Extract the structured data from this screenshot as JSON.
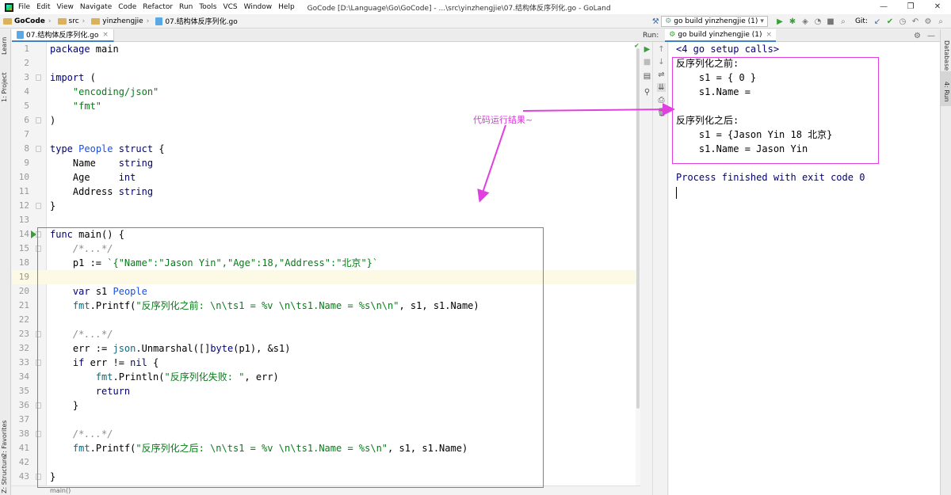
{
  "window": {
    "menu": [
      "File",
      "Edit",
      "View",
      "Navigate",
      "Code",
      "Refactor",
      "Run",
      "Tools",
      "VCS",
      "Window",
      "Help"
    ],
    "title": "GoCode [D:\\Language\\Go\\GoCode] - ...\\src\\yinzhengjie\\07.结构体反序列化.go - GoLand",
    "controls": [
      "—",
      "❐",
      "✕"
    ]
  },
  "navbar": {
    "breadcrumbs": [
      "GoCode",
      "src",
      "yinzhengjie",
      "07.结构体反序列化.go"
    ],
    "run_config": "go build yinzhengjie (1)",
    "git_label": "Git:"
  },
  "left_strip": [
    "1: Project",
    "Learn",
    "2: Favorites",
    "Z: Structure"
  ],
  "right_strip": [
    "Database",
    "4: Run"
  ],
  "editor": {
    "tab": "07.结构体反序列化.go",
    "status": "main()",
    "lines": [
      {
        "n": "1",
        "code": "package main"
      },
      {
        "n": "2",
        "code": ""
      },
      {
        "n": "3",
        "code": "import ("
      },
      {
        "n": "4",
        "code": "    \"encoding/json\""
      },
      {
        "n": "5",
        "code": "    \"fmt\""
      },
      {
        "n": "6",
        "code": ")"
      },
      {
        "n": "7",
        "code": ""
      },
      {
        "n": "8",
        "code": "type People struct {"
      },
      {
        "n": "9",
        "code": "    Name    string"
      },
      {
        "n": "10",
        "code": "    Age     int"
      },
      {
        "n": "11",
        "code": "    Address string"
      },
      {
        "n": "12",
        "code": "}"
      },
      {
        "n": "13",
        "code": ""
      },
      {
        "n": "14",
        "code": "func main() {"
      },
      {
        "n": "15",
        "code": "    /*...*/"
      },
      {
        "n": "18",
        "code": "    p1 := `{\"Name\":\"Jason Yin\",\"Age\":18,\"Address\":\"北京\"}`"
      },
      {
        "n": "19",
        "code": ""
      },
      {
        "n": "20",
        "code": "    var s1 People"
      },
      {
        "n": "21",
        "code": "    fmt.Printf(\"反序列化之前: \\n\\ts1 = %v \\n\\ts1.Name = %s\\n\\n\", s1, s1.Name)"
      },
      {
        "n": "22",
        "code": ""
      },
      {
        "n": "23",
        "code": "    /*...*/"
      },
      {
        "n": "32",
        "code": "    err := json.Unmarshal([]byte(p1), &s1)"
      },
      {
        "n": "33",
        "code": "    if err != nil {"
      },
      {
        "n": "34",
        "code": "        fmt.Println(\"反序列化失败: \", err)"
      },
      {
        "n": "35",
        "code": "        return"
      },
      {
        "n": "36",
        "code": "    }"
      },
      {
        "n": "37",
        "code": ""
      },
      {
        "n": "38",
        "code": "    /*...*/"
      },
      {
        "n": "41",
        "code": "    fmt.Printf(\"反序列化之后: \\n\\ts1 = %v \\n\\ts1.Name = %s\\n\", s1, s1.Name)"
      },
      {
        "n": "42",
        "code": ""
      },
      {
        "n": "43",
        "code": "}"
      }
    ]
  },
  "run_panel": {
    "label": "Run:",
    "tab": "go build yinzhengjie (1)",
    "output": [
      "<4 go setup calls>",
      "反序列化之前:",
      "    s1 = { 0 }",
      "    s1.Name =",
      "",
      "反序列化之后:",
      "    s1 = {Jason Yin 18 北京}",
      "    s1.Name = Jason Yin",
      "",
      "Process finished with exit code 0"
    ]
  },
  "annotation": {
    "note": "代码运行结果~",
    "color": "#e040e0"
  }
}
